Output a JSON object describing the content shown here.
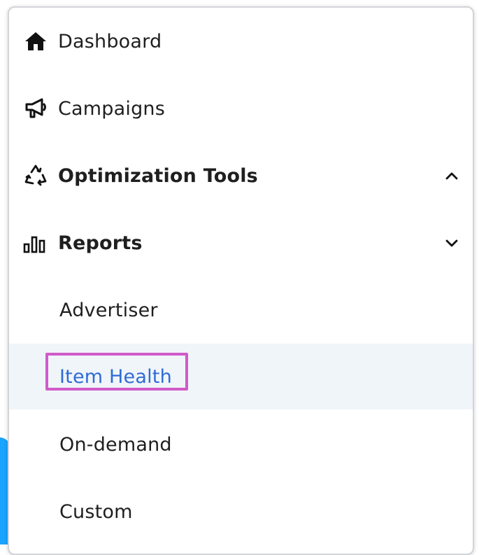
{
  "nav": {
    "items": [
      {
        "label": "Dashboard",
        "icon": "home-icon"
      },
      {
        "label": "Campaigns",
        "icon": "megaphone-icon"
      },
      {
        "label": "Optimization Tools",
        "icon": "recycle-icon",
        "expanded": true
      },
      {
        "label": "Reports",
        "icon": "bar-chart-icon",
        "expanded": false
      }
    ],
    "sub_items": [
      {
        "label": "Advertiser"
      },
      {
        "label": "Item Health",
        "selected": true
      },
      {
        "label": "On-demand"
      },
      {
        "label": "Custom"
      }
    ]
  },
  "colors": {
    "selected_text": "#2f6bd6",
    "selected_bg": "#f0f5fa",
    "highlight_border": "#d15bc9",
    "accent_edge": "#1aa3ff"
  }
}
